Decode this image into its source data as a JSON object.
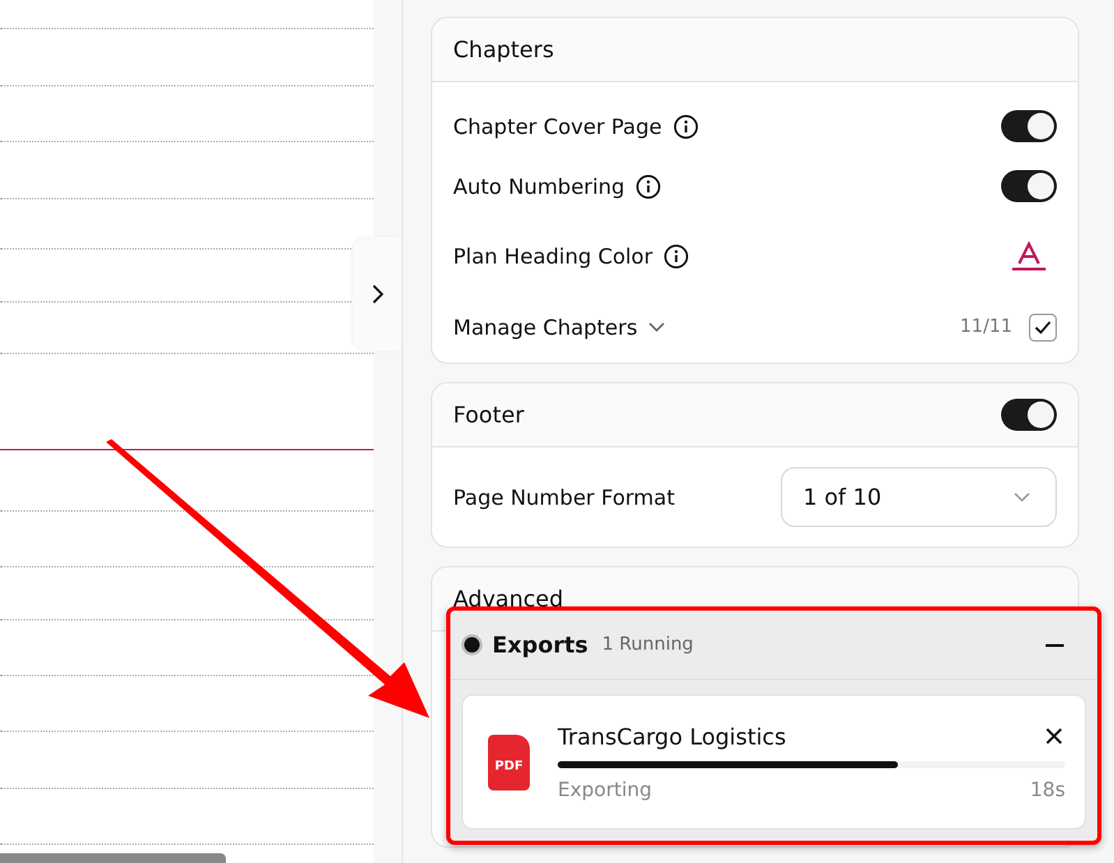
{
  "chapters": {
    "title": "Chapters",
    "rows": [
      {
        "kind": "toggle",
        "label": "Chapter Cover Page",
        "info": true,
        "on": true
      },
      {
        "kind": "toggle",
        "label": "Auto Numbering",
        "info": true,
        "on": true
      },
      {
        "kind": "color",
        "label": "Plan Heading Color",
        "info": true,
        "color": "#c2185b"
      },
      {
        "kind": "manage",
        "label": "Manage Chapters",
        "count": "11/11",
        "checked": true
      }
    ]
  },
  "footer": {
    "title": "Footer",
    "on": true,
    "rows": [
      {
        "kind": "select",
        "label": "Page Number Format",
        "value": "1 of 10"
      }
    ]
  },
  "advanced": {
    "title": "Advanced"
  },
  "exports": {
    "title": "Exports",
    "status": "1 Running",
    "items": [
      {
        "name": "TransCargo Logistics",
        "file_type": "PDF",
        "status": "Exporting",
        "time": "18s",
        "level": 0.67
      }
    ]
  }
}
